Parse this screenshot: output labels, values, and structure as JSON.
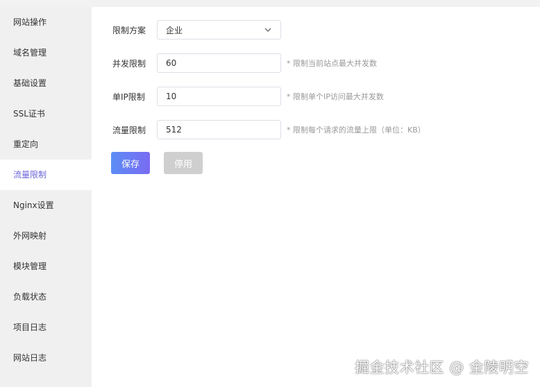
{
  "sidebar": {
    "items": [
      {
        "label": "网站操作"
      },
      {
        "label": "域名管理"
      },
      {
        "label": "基础设置"
      },
      {
        "label": "SSL证书"
      },
      {
        "label": "重定向"
      },
      {
        "label": "流量限制",
        "active": true
      },
      {
        "label": "Nginx设置"
      },
      {
        "label": "外网映射"
      },
      {
        "label": "模块管理"
      },
      {
        "label": "负载状态"
      },
      {
        "label": "项目日志"
      },
      {
        "label": "网站日志"
      }
    ]
  },
  "form": {
    "plan": {
      "label": "限制方案",
      "value": "企业"
    },
    "concurrency": {
      "label": "并发限制",
      "value": "60",
      "hint": "* 限制当前站点最大并发数"
    },
    "per_ip": {
      "label": "单IP限制",
      "value": "10",
      "hint": "* 限制单个IP访问最大并发数"
    },
    "traffic": {
      "label": "流量限制",
      "value": "512",
      "hint": "* 限制每个请求的流量上限（单位：KB）"
    }
  },
  "buttons": {
    "save": "保存",
    "disable": "停用"
  },
  "watermark": "掘金技术社区 @ 金陵明空",
  "colors": {
    "accent": "#6b63d9",
    "button_start": "#5b8df5",
    "button_end": "#7a6bf2",
    "disabled": "#cfcfcf"
  }
}
